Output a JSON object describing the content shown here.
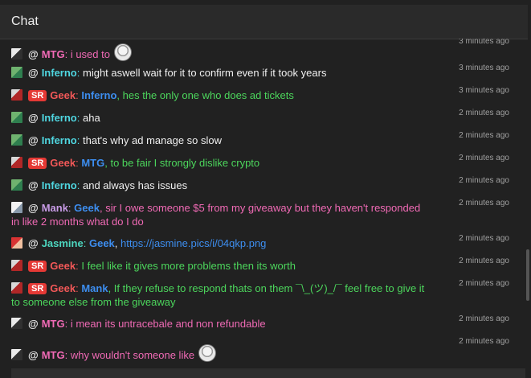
{
  "header": {
    "title": "Chat"
  },
  "messages": [
    {
      "id": "m0",
      "time": "3 minutes ago"
    },
    {
      "id": "m1",
      "user": "MTG",
      "at": "@",
      "text": "i used to",
      "time": ""
    },
    {
      "id": "m2",
      "user": "Inferno",
      "at": "@",
      "text": "might aswell wait for it to confirm even if it took years",
      "time": "3 minutes ago"
    },
    {
      "id": "m3",
      "badge": "SR",
      "user": "Geek",
      "at": "@",
      "mention": "Inferno",
      "text": ", hes the only one who does ad tickets",
      "time": "3 minutes ago"
    },
    {
      "id": "m4",
      "user": "Inferno",
      "at": "@",
      "text": "aha",
      "time": "2 minutes ago"
    },
    {
      "id": "m5",
      "user": "Inferno",
      "at": "@",
      "text": "that's why ad manage so slow",
      "time": "2 minutes ago"
    },
    {
      "id": "m6",
      "badge": "SR",
      "user": "Geek",
      "at": "@",
      "mention": "MTG",
      "text": ", to be fair I strongly dislike crypto",
      "time": "2 minutes ago"
    },
    {
      "id": "m7",
      "user": "Inferno",
      "at": "@",
      "text": "and always has issues",
      "time": "2 minutes ago"
    },
    {
      "id": "m8",
      "user": "Mank",
      "at": "@",
      "mention": "Geek",
      "text": ", sir I owe someone $5 from my giveaway but they haven't responded in like 2 months what do I do",
      "time": "2 minutes ago"
    },
    {
      "id": "m9",
      "user": "Jasmine",
      "at": "@",
      "mention": "Geek",
      "sep": ", ",
      "link": "https://jasmine.pics/i/04qkp.png",
      "time": "2 minutes ago"
    },
    {
      "id": "m10",
      "badge": "SR",
      "user": "Geek",
      "at": "@",
      "text": "I feel like it gives more problems then its worth",
      "time": "2 minutes ago"
    },
    {
      "id": "m11",
      "badge": "SR",
      "user": "Geek",
      "at": "@",
      "mention": "Mank",
      "text": ", If they refuse to respond thats on them ¯\\_(ツ)_/¯ feel free to give it to someone else from the giveaway",
      "time": "2 minutes ago"
    },
    {
      "id": "m12",
      "user": "MTG",
      "at": "@",
      "text": "i mean its untracebale and non refundable",
      "time": "2 minutes ago"
    },
    {
      "id": "m13",
      "user": "MTG",
      "at": "@",
      "text": "why wouldn't someone like",
      "time": "2 minutes ago"
    }
  ],
  "labels": {
    "colon": ":"
  }
}
